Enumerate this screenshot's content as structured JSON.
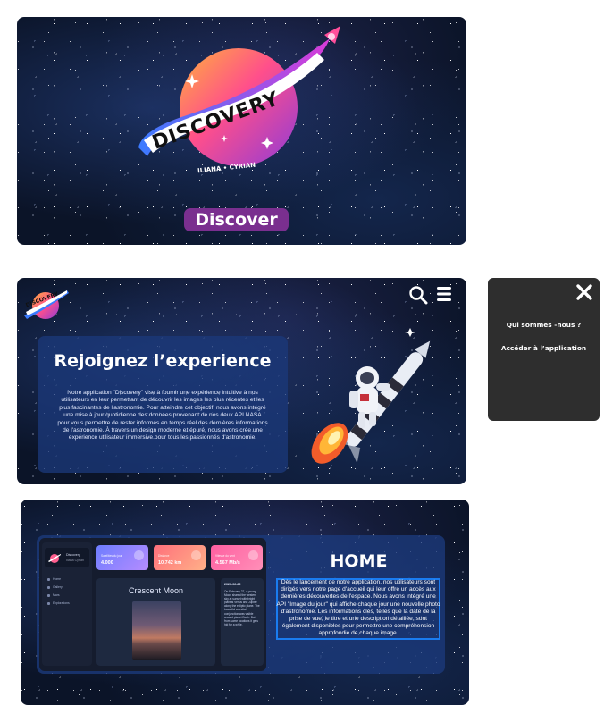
{
  "colors": {
    "space_bg": "#0b1428",
    "card_blue": "#1b397a",
    "discover_button": "#7a2f8f",
    "menu_bg": "#2e2e2e",
    "highlight": "#1a7cf0"
  },
  "splash": {
    "logo": {
      "word": "DISCOVERY",
      "subtitle": "ILIANA • CYRIAN"
    },
    "discover_label": "Discover"
  },
  "join": {
    "logo_word": "DISCOVERY",
    "search_icon": "search-icon",
    "menu_icon": "hamburger-icon",
    "title": "Rejoignez l’experience",
    "text": "Notre application \"Discovery\" vise à fournir une expérience intuitive à nos utilisateurs en leur permettant de découvrir les images les plus récentes et les plus fascinantes de l'astronomie. Pour atteindre cet objectif, nous avons intégré une mise à jour quotidienne des données provenant de nos deux API NASA pour vous permettre de rester informés en temps réel des dernières informations de l'astronomie. À travers un design moderne et épuré, nous avons crée une expérience utilisateur immersive.pour tous les passionnés d'astronomie."
  },
  "menu": {
    "close_icon": "close-icon",
    "items": [
      "Qui sommes -nous ?",
      "Accéder à l’application"
    ]
  },
  "home": {
    "title": "HOME",
    "text": "Dès le lancement de notre application, nos utilisateurs sont dirigés vers notre page d'accueil qui leur offre un accès aux dernières découvertes de l'espace. Nous avons intégré une API \"Image du jour\" qui affiche chaque jour une nouvelle photo d'astronomie. Les informations clés, telles que la date de la prise de vue, le titre et une description détaillée, sont également disponibles pour permettre une compréhension approfondie de chaque image.",
    "app": {
      "brand": "Discovery",
      "brand_sub": "Iliana Cyrian",
      "nav": [
        "Home",
        "Gallery",
        "Mars",
        "Explorations"
      ],
      "stats": [
        {
          "label": "Satellites du jour",
          "value": "4.000"
        },
        {
          "label": "Distance",
          "value": "10.742 km"
        },
        {
          "label": "Vitesse du vent",
          "value": "4.567 Mb/s"
        }
      ],
      "picture_title": "Crescent Moon",
      "picture_date": "2020-02-25",
      "picture_text": "On February 27, a young Moon shared the western sky at sunset with bright planets Venus and Jupiter along the ecliptic plane. The beautiful celestial conjunction was visible around planet Earth. But from some locations it gets hid for a while."
    }
  }
}
